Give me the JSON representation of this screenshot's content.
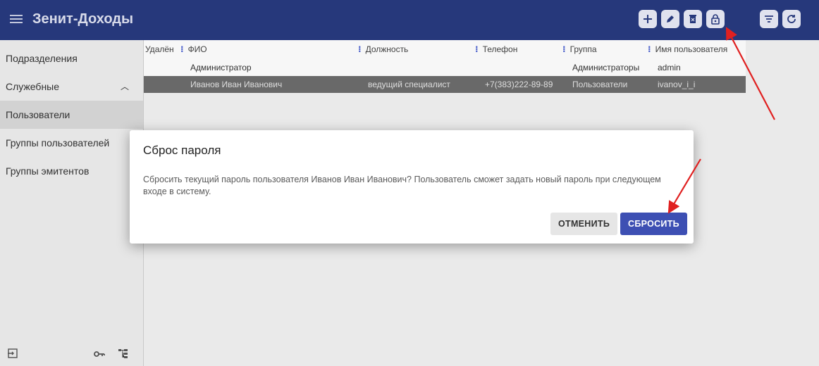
{
  "app": {
    "title": "Зенит-Доходы"
  },
  "sidebar": {
    "items": [
      {
        "label": "Подразделения"
      },
      {
        "label": "Служебные"
      },
      {
        "label": "Пользователи"
      },
      {
        "label": "Группы пользователей"
      },
      {
        "label": "Группы эмитентов"
      }
    ],
    "bottom_icons": [
      "logout-icon",
      "key-icon",
      "hierarchy-icon"
    ]
  },
  "toolbar": {
    "buttons": [
      "add-icon",
      "edit-icon",
      "delete-icon",
      "lock-reset-icon",
      "filter-icon",
      "refresh-icon"
    ]
  },
  "table": {
    "columns": [
      "Удалён",
      "ФИО",
      "Должность",
      "Телефон",
      "Группа",
      "Имя пользователя"
    ],
    "rows": [
      [
        "",
        "Администратор",
        "",
        "",
        "Администраторы",
        "admin"
      ],
      [
        "",
        "Иванов Иван Иванович",
        "ведущий специалист",
        "+7(383)222-89-89",
        "Пользователи",
        "ivanov_i_i"
      ]
    ]
  },
  "dialog": {
    "title": "Сброс пароля",
    "message": "Сбросить текущий пароль пользователя Иванов Иван Иванович? Пользователь сможет задать новый пароль при следующем входе в систему.",
    "cancel_label": "ОТМЕНИТЬ",
    "confirm_label": "СБРОСИТЬ"
  },
  "colors": {
    "appbar": "#283a7f",
    "primary_button": "#3d4fb3",
    "annotation_arrow": "#e02020"
  }
}
